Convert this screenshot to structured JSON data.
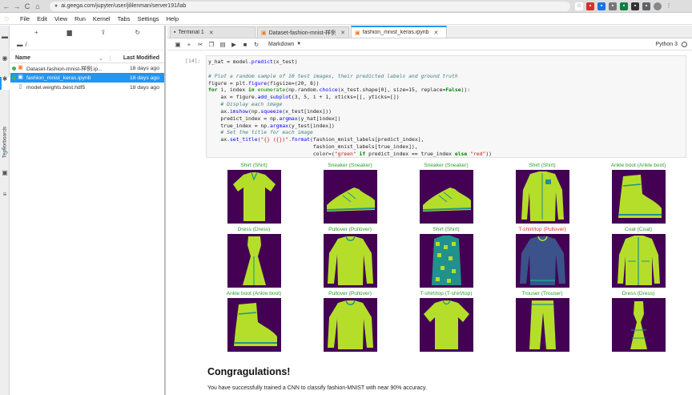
{
  "browser": {
    "url": "ai.geega.com/jupyter/user/jililenman/server191/lab",
    "back": "←",
    "forward": "→",
    "reload": "C",
    "home": "⌂"
  },
  "menu": {
    "items": [
      "File",
      "Edit",
      "View",
      "Run",
      "Kernel",
      "Tabs",
      "Settings",
      "Help"
    ]
  },
  "sidebar": {
    "tensorboards_label": "Tensorboards"
  },
  "file_browser": {
    "path": "/",
    "col_name": "Name",
    "col_modified": "Last Modified",
    "files": [
      {
        "name": "Dataset-fashion-mnist-样例.ip...",
        "modified": "18 days ago",
        "selected": false,
        "running": true,
        "kind": "notebook"
      },
      {
        "name": "fashion_mnist_keras.ipynb",
        "modified": "18 days ago",
        "selected": true,
        "running": true,
        "kind": "notebook"
      },
      {
        "name": "model.weights.best.hdf5",
        "modified": "18 days ago",
        "selected": false,
        "running": false,
        "kind": "file"
      }
    ]
  },
  "tabs": [
    {
      "label": "Terminal 1",
      "icon": "terminal-icon",
      "active": false
    },
    {
      "label": "Dataset-fashion-mnist-样例",
      "icon": "notebook-icon",
      "active": false
    },
    {
      "label": "fashion_mnist_keras.ipynb",
      "icon": "notebook-icon",
      "active": true
    }
  ],
  "notebook": {
    "cell_type": "Markdown",
    "kernel": "Python 3",
    "prompt": "[14]:",
    "code_lines": [
      "y_hat = model.predict(x_test)",
      "",
      "# Plot a random sample of 10 test images, their predicted labels and ground truth",
      "figure = plt.figure(figsize=(20, 8))",
      "for i, index in enumerate(np.random.choice(x_test.shape[0], size=15, replace=False)):",
      "    ax = figure.add_subplot(3, 5, i + 1, xticks=[], yticks=[])",
      "    # Display each image",
      "    ax.imshow(np.squeeze(x_test[index]))",
      "    predict_index = np.argmax(y_hat[index])",
      "    true_index = np.argmax(y_test[index])",
      "    # Set the title for each image",
      "    ax.set_title(\"{} ({})\".format(fashion_mnist_labels[predict_index],",
      "                                  fashion_mnist_labels[true_index]),",
      "                                  color=(\"green\" if predict_index == true_index else \"red\"))"
    ],
    "predictions": [
      {
        "title": "Shirt (Shirt)",
        "correct": true,
        "item": "shirt"
      },
      {
        "title": "Sneaker (Sneaker)",
        "correct": true,
        "item": "sneaker"
      },
      {
        "title": "Sneaker (Sneaker)",
        "correct": true,
        "item": "sneaker"
      },
      {
        "title": "Shirt (Shirt)",
        "correct": true,
        "item": "shirt-long"
      },
      {
        "title": "Ankle boot (Ankle boot)",
        "correct": true,
        "item": "boot"
      },
      {
        "title": "Dress (Dress)",
        "correct": true,
        "item": "dress"
      },
      {
        "title": "Pullover (Pullover)",
        "correct": true,
        "item": "pullover"
      },
      {
        "title": "Shirt (Shirt)",
        "correct": true,
        "item": "shirt-pattern"
      },
      {
        "title": "T-shirt/top (Pullover)",
        "correct": false,
        "item": "pullover-dark"
      },
      {
        "title": "Coat (Coat)",
        "correct": true,
        "item": "coat"
      },
      {
        "title": "Ankle boot (Ankle boot)",
        "correct": true,
        "item": "boot"
      },
      {
        "title": "Pullover (Pullover)",
        "correct": true,
        "item": "pullover"
      },
      {
        "title": "T-shirt/top (T-shirt/top)",
        "correct": true,
        "item": "tshirt"
      },
      {
        "title": "Trouser (Trouser)",
        "correct": true,
        "item": "trouser"
      },
      {
        "title": "Dress (Dress)",
        "correct": true,
        "item": "dress-short"
      }
    ],
    "markdown_heading": "Congragulations!",
    "markdown_text": "You have successfully trained a CNN to classify fashion-MNIST with near 90% accuracy."
  },
  "colors": {
    "accent": "#2196f3",
    "correct": "#2e9d2e",
    "wrong": "#e0322b",
    "viridis_bg": "#440154",
    "viridis_fg": "#b5de2b",
    "viridis_mid": "#21918c",
    "jupyter_orange": "#f37726"
  }
}
